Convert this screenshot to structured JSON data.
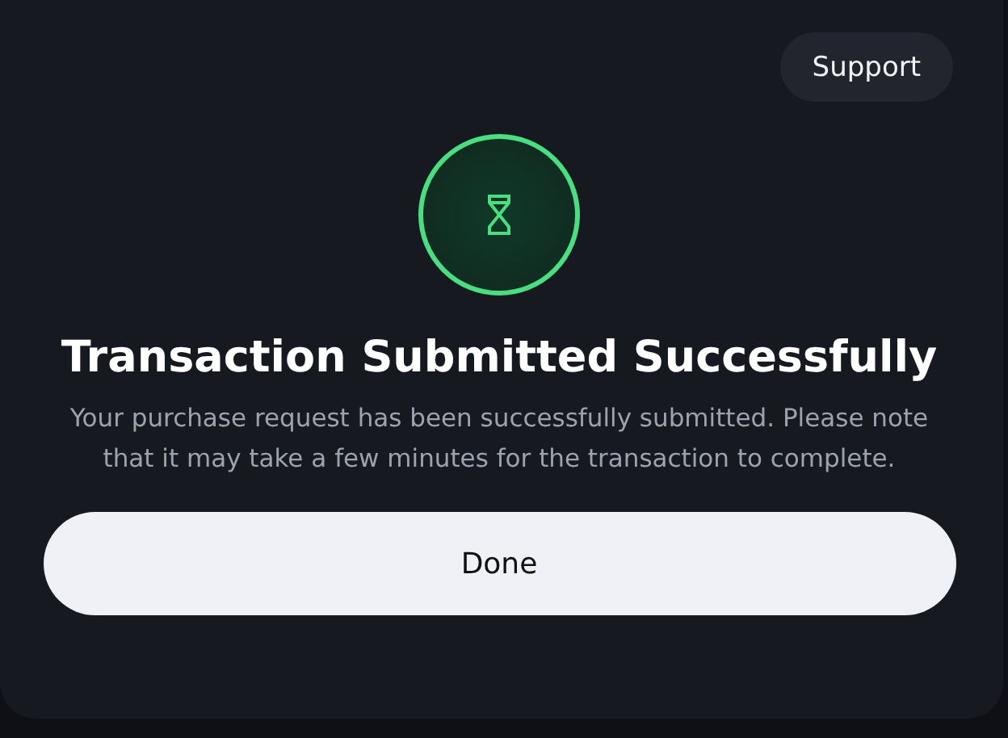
{
  "support_button": "Support",
  "status": {
    "kind": "pending"
  },
  "title": "Transaction Submitted Successfully",
  "message": "Your purchase request has been successfully submitted. Please note that it may take a few minutes for the transaction to complete.",
  "done_button": "Done"
}
